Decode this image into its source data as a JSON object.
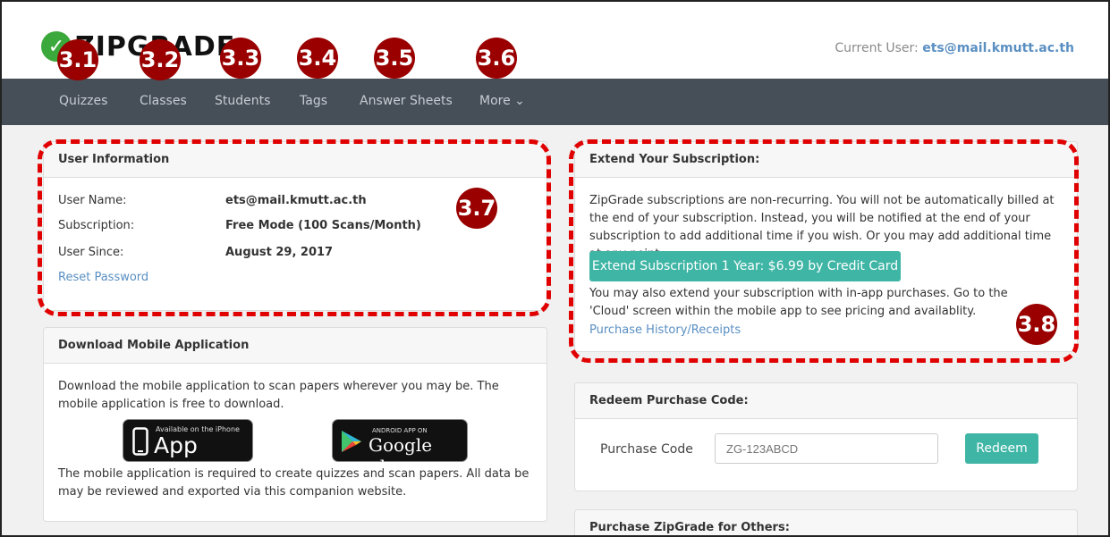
{
  "header": {
    "logo_text": "ZIPGRADE",
    "current_user_label": "Current User:",
    "current_user_value": "ets@mail.kmutt.ac.th"
  },
  "nav": {
    "items": [
      {
        "label": "Quizzes"
      },
      {
        "label": "Classes"
      },
      {
        "label": "Students"
      },
      {
        "label": "Tags"
      },
      {
        "label": "Answer Sheets"
      },
      {
        "label": "More ⌄"
      }
    ]
  },
  "badges": [
    "3.1",
    "3.2",
    "3.3",
    "3.4",
    "3.5",
    "3.6",
    "3.7",
    "3.8"
  ],
  "user_info": {
    "title": "User Information",
    "username_label": "User Name:",
    "username_value": "ets@mail.kmutt.ac.th",
    "subscription_label": "Subscription:",
    "subscription_value": "Free Mode (100 Scans/Month)",
    "since_label": "User Since:",
    "since_value": "August 29, 2017",
    "reset_link": "Reset Password"
  },
  "download": {
    "title": "Download Mobile Application",
    "text1": "Download the mobile application to scan papers wherever you may be. The mobile application is free to download.",
    "appstore_small": "Available on the iPhone",
    "appstore_big": "App Store",
    "google_small": "ANDROID APP ON",
    "google_big": "Google play",
    "text2": "The mobile application is required to create quizzes and scan papers. All data be may be reviewed and exported via this companion website."
  },
  "extend": {
    "title": "Extend Your Subscription:",
    "text1": "ZipGrade subscriptions are non-recurring. You will not be automatically billed at the end of your subscription. Instead, you will be notified at the end of your subscription to add additional time if you wish. Or you may add additional time at any point.",
    "button": "Extend Subscription 1 Year: $6.99 by Credit Card",
    "text2": "You may also extend your subscription with in-app purchases. Go to the 'Cloud' screen within the mobile app to see pricing and availablity.",
    "history_link": "Purchase History/Receipts"
  },
  "redeem": {
    "title": "Redeem Purchase Code:",
    "label": "Purchase Code",
    "placeholder": "ZG-123ABCD",
    "button": "Redeem"
  },
  "others": {
    "title": "Purchase ZipGrade for Others:"
  }
}
